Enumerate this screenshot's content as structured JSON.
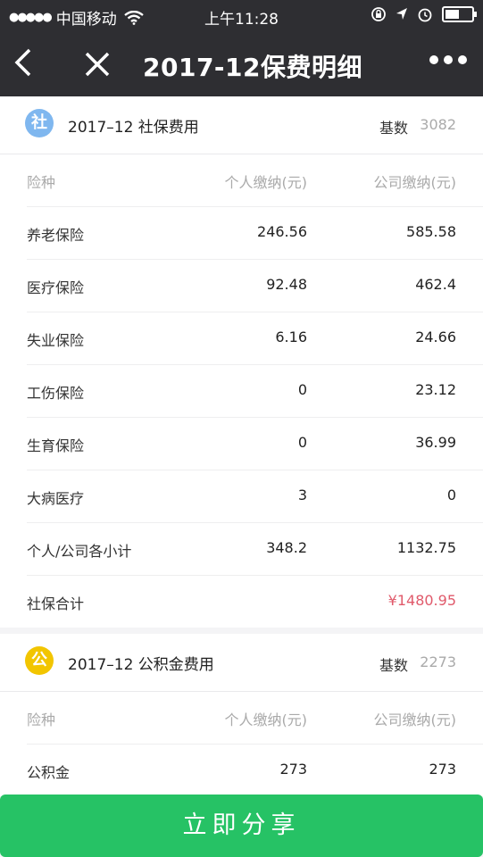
{
  "status": {
    "carrier": "中国移动",
    "time": "上午11:28"
  },
  "nav": {
    "title": "2017-12保费明细"
  },
  "social": {
    "badge": "社",
    "title": "2017–12 社保费用",
    "base_label": "基数",
    "base_value": "3082",
    "header": [
      "险种",
      "个人缴纳(元)",
      "公司缴纳(元)"
    ],
    "rows": [
      [
        "养老保险",
        "246.56",
        "585.58"
      ],
      [
        "医疗保险",
        "92.48",
        "462.4"
      ],
      [
        "失业保险",
        "6.16",
        "24.66"
      ],
      [
        "工伤保险",
        "0",
        "23.12"
      ],
      [
        "生育保险",
        "0",
        "36.99"
      ],
      [
        "大病医疗",
        "3",
        "0"
      ],
      [
        "个人/公司各小计",
        "348.2",
        "1132.75"
      ]
    ],
    "total_label": "社保合计",
    "total_value": "¥1480.95"
  },
  "fund": {
    "badge": "公",
    "title": "2017–12 公积金费用",
    "base_label": "基数",
    "base_value": "2273",
    "header": [
      "险种",
      "个人缴纳(元)",
      "公司缴纳(元)"
    ],
    "rows": [
      [
        "公积金",
        "273",
        "273"
      ]
    ]
  },
  "share_label": "立即分享",
  "colors": {
    "bar": "#2e2e32",
    "social_badge": "#7fb7ef",
    "fund_badge": "#f2c500",
    "share": "#26c265",
    "total": "#e05a6b"
  }
}
